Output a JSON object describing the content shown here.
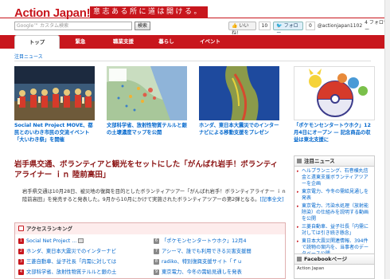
{
  "header": {
    "logo": "Action Japan",
    "logo_bang": "!",
    "tagline": "意志ある所に道は開ける。",
    "search_placeholder": "Google™ カスタム検索",
    "search_button": "検索",
    "like_label": "いいね!",
    "like_count": "10",
    "follow_label": "フォロー",
    "follow_count": "0",
    "handle": "@actionjapan1102",
    "followers": "4 フォロワー"
  },
  "nav": {
    "items": [
      "トップ",
      "緊急",
      "職業支援",
      "暮らし",
      "イベント"
    ]
  },
  "breadcrumb": "注目ニュース",
  "photos": [
    {
      "caption": "Social Net Project MOVE、都民とのいわき市民の交流イベント「大いわき祭」を開催"
    },
    {
      "caption": "文部科学省、放射性物質テルルと銀の土壌濃度マップを公開"
    },
    {
      "caption": "ホンダ、東日本大震災でのインターナビによる移動支援をプレゼン"
    }
  ],
  "side_feature": {
    "caption": "「ポケモンセンタートウホク」12月4日にオープン — 記念商品の収益は東北支援に"
  },
  "article": {
    "headline": "岩手県交通、ボランティアと観光をセットにした「がんばれ岩手！ボランティアライナー ｉｎ 陸前高田」",
    "body": "岩手県交通は10月28日、被災地の復興を目的としたボランティアツアー「がんばれ岩手！ボランティアライナー ｉｎ 陸前高田」を発売すると発表した。9月から10月にかけて実施されたボランティアツアーの第2弾となる。",
    "more": "[記事全文]"
  },
  "ranking": {
    "title": "アクセスランキング",
    "items": [
      {
        "n": "1",
        "text": "Social Net Project ..."
      },
      {
        "n": "2",
        "text": "ホンダ、東日本大震災でのインターナビ"
      },
      {
        "n": "3",
        "text": "三菱自動車、益子社長「内需に対しては"
      },
      {
        "n": "4",
        "text": "文部科学省、放射性物質テルルと銀の土"
      },
      {
        "n": "6",
        "text": "「ポケモンセンタートウホク」12月4"
      },
      {
        "n": "7",
        "text": "アシーマ、誰でも利用できる災害支援間"
      },
      {
        "n": "8",
        "text": "radiko、特別復興支援サイト「ｆｕ"
      },
      {
        "n": "9",
        "text": "東京電力、今冬の需給見通しを発表"
      }
    ]
  },
  "sidebar_news": {
    "title": "注目ニュース",
    "items": [
      "ヘルプランニング、石巻横丸信金と遠東支援ボランティアツアーを企画",
      "東京電力、今冬の需給見通しを発表",
      "東京電力、汚染水処理（放射能除染）の仕組みを説明する動画を公開",
      "三菱自動車、益子社長「内需に対しては引き続き懸念」",
      "東日本大震災関連情報、394件で読物の案内を、当事者のデータベース公開"
    ]
  },
  "facebook": {
    "title": "Facebookページ",
    "body": "Action Japan"
  },
  "colors": {
    "brand": "#c8161d",
    "link": "#0066cc"
  }
}
